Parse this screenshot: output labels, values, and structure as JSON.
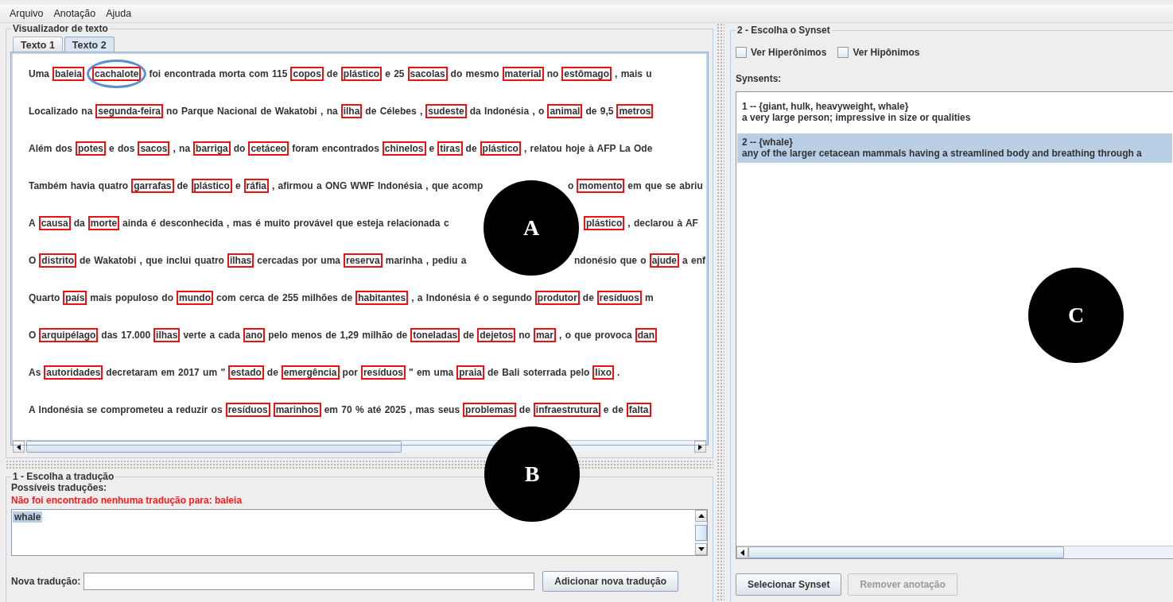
{
  "menu": [
    "Arquivo",
    "Anotação",
    "Ajuda"
  ],
  "text_viewer": {
    "title": "Visualizador de texto",
    "tabs": [
      {
        "label": "Texto 1",
        "selected": false
      },
      {
        "label": "Texto 2",
        "selected": true
      }
    ],
    "lines": [
      [
        {
          "kind": "text",
          "text": "Uma"
        },
        {
          "kind": "word",
          "text": "baleia"
        },
        {
          "kind": "word",
          "text": "cachalote",
          "circled": true
        },
        {
          "kind": "text",
          "text": "foi encontrada morta com 115"
        },
        {
          "kind": "word",
          "text": "copos"
        },
        {
          "kind": "text",
          "text": "de"
        },
        {
          "kind": "word",
          "text": "plástico"
        },
        {
          "kind": "text",
          "text": "e 25"
        },
        {
          "kind": "word",
          "text": "sacolas"
        },
        {
          "kind": "text",
          "text": "do mesmo"
        },
        {
          "kind": "word",
          "text": "material"
        },
        {
          "kind": "text",
          "text": "no"
        },
        {
          "kind": "word",
          "text": "estômago"
        },
        {
          "kind": "text",
          "text": ", mais u"
        }
      ],
      [
        {
          "kind": "text",
          "text": "Localizado na"
        },
        {
          "kind": "word",
          "text": "segunda-feira"
        },
        {
          "kind": "text",
          "text": "no Parque Nacional de Wakatobi , na"
        },
        {
          "kind": "word",
          "text": "ilha"
        },
        {
          "kind": "text",
          "text": "de Célebes ,"
        },
        {
          "kind": "word",
          "text": "sudeste"
        },
        {
          "kind": "text",
          "text": "da Indonésia , o"
        },
        {
          "kind": "word",
          "text": "animal"
        },
        {
          "kind": "text",
          "text": "de 9,5"
        },
        {
          "kind": "word",
          "text": "metros"
        }
      ],
      [
        {
          "kind": "text",
          "text": "Além dos"
        },
        {
          "kind": "word",
          "text": "potes"
        },
        {
          "kind": "text",
          "text": "e dos"
        },
        {
          "kind": "word",
          "text": "sacos"
        },
        {
          "kind": "text",
          "text": ", na"
        },
        {
          "kind": "word",
          "text": "barriga"
        },
        {
          "kind": "text",
          "text": "do"
        },
        {
          "kind": "word",
          "text": "cetáceo"
        },
        {
          "kind": "text",
          "text": "foram encontrados"
        },
        {
          "kind": "word",
          "text": "chinelos"
        },
        {
          "kind": "text",
          "text": "e"
        },
        {
          "kind": "word",
          "text": "tiras"
        },
        {
          "kind": "text",
          "text": "de"
        },
        {
          "kind": "word",
          "text": "plástico"
        },
        {
          "kind": "text",
          "text": ", relatou hoje à AFP La Ode"
        }
      ],
      [
        {
          "kind": "text",
          "text": "Também havia quatro"
        },
        {
          "kind": "word",
          "text": "garrafas"
        },
        {
          "kind": "text",
          "text": "de"
        },
        {
          "kind": "word",
          "text": "plástico"
        },
        {
          "kind": "text",
          "text": "e"
        },
        {
          "kind": "word",
          "text": "ráfia"
        },
        {
          "kind": "text",
          "text": ", afirmou a ONG WWF Indonésia , que acomp"
        },
        {
          "kind": "gap"
        },
        {
          "kind": "text",
          "text": "o"
        },
        {
          "kind": "word",
          "text": "momento"
        },
        {
          "kind": "text",
          "text": "em que se abriu"
        }
      ],
      [
        {
          "kind": "text",
          "text": "A"
        },
        {
          "kind": "word",
          "text": "causa"
        },
        {
          "kind": "text",
          "text": "da"
        },
        {
          "kind": "word",
          "text": "morte"
        },
        {
          "kind": "text",
          "text": "ainda é desconhecida , mas é muito provável que esteja relacionada c"
        },
        {
          "kind": "gap"
        },
        {
          "kind": "word",
          "text": "plástico"
        },
        {
          "kind": "text",
          "text": ", declarou à AF"
        }
      ],
      [
        {
          "kind": "text",
          "text": "O"
        },
        {
          "kind": "word",
          "text": "distrito"
        },
        {
          "kind": "text",
          "text": "de Wakatobi , que inclui quatro"
        },
        {
          "kind": "word",
          "text": "ilhas"
        },
        {
          "kind": "text",
          "text": "cercadas por uma"
        },
        {
          "kind": "word",
          "text": "reserva"
        },
        {
          "kind": "text",
          "text": "marinha , pediu a"
        },
        {
          "kind": "gap"
        },
        {
          "kind": "text",
          "text": "ndonésio que o"
        },
        {
          "kind": "word",
          "text": "ajude"
        },
        {
          "kind": "text",
          "text": "a enf"
        }
      ],
      [
        {
          "kind": "text",
          "text": "Quarto"
        },
        {
          "kind": "word",
          "text": "país"
        },
        {
          "kind": "text",
          "text": "mais populoso do"
        },
        {
          "kind": "word",
          "text": "mundo"
        },
        {
          "kind": "text",
          "text": "com cerca de 255 milhões de"
        },
        {
          "kind": "word",
          "text": "habitantes"
        },
        {
          "kind": "text",
          "text": ", a Indonésia é o segundo"
        },
        {
          "kind": "word",
          "text": "produtor"
        },
        {
          "kind": "text",
          "text": "de"
        },
        {
          "kind": "word",
          "text": "resíduos"
        },
        {
          "kind": "text",
          "text": "m"
        }
      ],
      [
        {
          "kind": "text",
          "text": "O"
        },
        {
          "kind": "word",
          "text": "arquipélago"
        },
        {
          "kind": "text",
          "text": "das 17.000"
        },
        {
          "kind": "word",
          "text": "ilhas"
        },
        {
          "kind": "text",
          "text": "verte a cada"
        },
        {
          "kind": "word",
          "text": "ano"
        },
        {
          "kind": "text",
          "text": "pelo menos de 1,29 milhão de"
        },
        {
          "kind": "word",
          "text": "toneladas"
        },
        {
          "kind": "text",
          "text": "de"
        },
        {
          "kind": "word",
          "text": "dejetos"
        },
        {
          "kind": "text",
          "text": "no"
        },
        {
          "kind": "word",
          "text": "mar"
        },
        {
          "kind": "text",
          "text": ", o que provoca"
        },
        {
          "kind": "word",
          "text": "dan"
        }
      ],
      [
        {
          "kind": "text",
          "text": "As"
        },
        {
          "kind": "word",
          "text": "autoridades"
        },
        {
          "kind": "text",
          "text": "decretaram em 2017 um \""
        },
        {
          "kind": "word",
          "text": "estado"
        },
        {
          "kind": "text",
          "text": "de"
        },
        {
          "kind": "word",
          "text": "emergência"
        },
        {
          "kind": "text",
          "text": "por"
        },
        {
          "kind": "word",
          "text": "resíduos"
        },
        {
          "kind": "text",
          "text": "\" em uma"
        },
        {
          "kind": "word",
          "text": "praia"
        },
        {
          "kind": "text",
          "text": "de Bali soterrada pelo"
        },
        {
          "kind": "word",
          "text": "lixo"
        },
        {
          "kind": "text",
          "text": "."
        }
      ],
      [
        {
          "kind": "text",
          "text": "A Indonésia se comprometeu a reduzir os"
        },
        {
          "kind": "word",
          "text": "resíduos"
        },
        {
          "kind": "word",
          "text": "marinhos"
        },
        {
          "kind": "text",
          "text": "em 70 % até 2025 , mas seus"
        },
        {
          "kind": "word",
          "text": "problemas"
        },
        {
          "kind": "text",
          "text": "de"
        },
        {
          "kind": "word",
          "text": "infraestrutura"
        },
        {
          "kind": "text",
          "text": "e de"
        },
        {
          "kind": "word",
          "text": "falta"
        }
      ]
    ]
  },
  "translation": {
    "title": "1 - Escolha a tradução",
    "label": "Possíveis traduções:",
    "error": "Não foi encontrado nenhuma tradução para: baleia",
    "options": [
      {
        "text": "whale",
        "selected": true
      }
    ],
    "new_label": "Nova tradução:",
    "add_button": "Adicionar nova tradução"
  },
  "synset": {
    "title": "2 - Escolha o Synset",
    "checkboxes": [
      {
        "label": "Ver Hiperônimos",
        "checked": false
      },
      {
        "label": "Ver Hipônimos",
        "checked": false
      }
    ],
    "list_label": "Synsents:",
    "items": [
      {
        "head": "1 -- {giant, hulk, heavyweight, whale}",
        "gloss": "a very large person; impressive in size or qualities",
        "selected": false
      },
      {
        "head": "2 -- {whale}",
        "gloss": "any of the larger cetacean mammals having a streamlined body and breathing through a",
        "selected": true
      }
    ],
    "buttons": [
      {
        "label": "Selecionar Synset",
        "disabled": false
      },
      {
        "label": "Remover anotação",
        "disabled": true
      }
    ]
  },
  "markers": [
    {
      "label": "A"
    },
    {
      "label": "B"
    },
    {
      "label": "C"
    }
  ]
}
